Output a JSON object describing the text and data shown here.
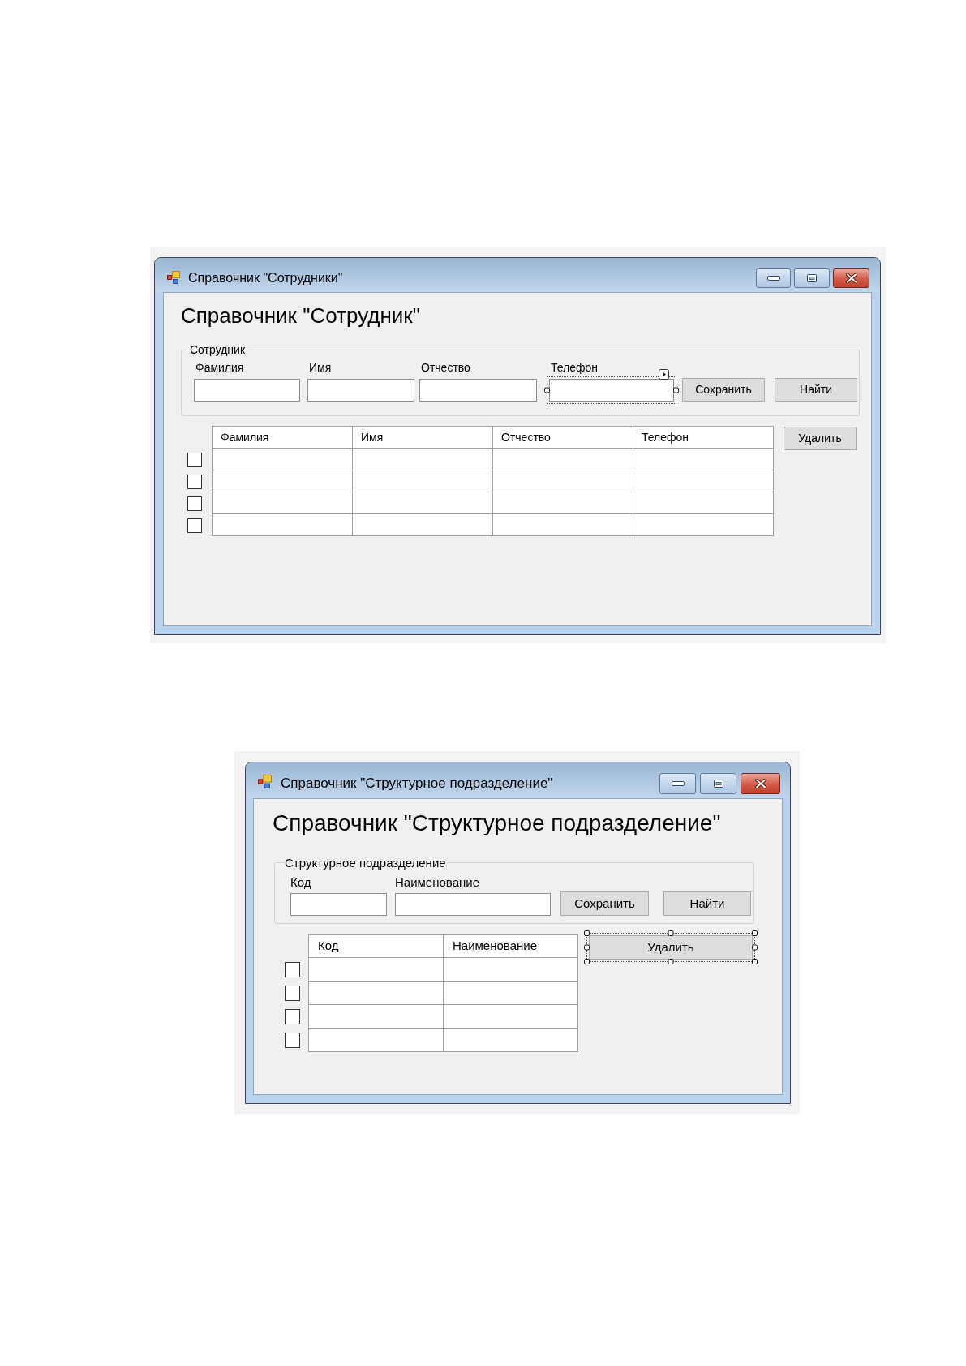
{
  "windows": [
    {
      "title": "Справочник \"Сотрудники\"",
      "heading": "Справочник \"Сотрудник\"",
      "group": {
        "legend": "Сотрудник",
        "fields": [
          {
            "label": "Фамилия",
            "selected": false
          },
          {
            "label": "Имя",
            "selected": false
          },
          {
            "label": "Отчество",
            "selected": false
          },
          {
            "label": "Телефон",
            "selected": true
          }
        ],
        "buttons": [
          {
            "label": "Сохранить",
            "selected": false
          },
          {
            "label": "Найти",
            "selected": false
          }
        ]
      },
      "grid": {
        "columns": [
          "Фамилия",
          "Имя",
          "Отчество",
          "Телефон"
        ],
        "rows": [
          {
            "checked": false
          },
          {
            "checked": false
          },
          {
            "checked": false
          },
          {
            "checked": false
          }
        ]
      },
      "delete_button": {
        "label": "Удалить",
        "selected": false
      }
    },
    {
      "title": "Справочник \"Структурное подразделение\"",
      "heading": "Справочник \"Структурное подразделение\"",
      "group": {
        "legend": "Структурное подразделение",
        "fields": [
          {
            "label": "Код",
            "selected": false
          },
          {
            "label": "Наименование",
            "selected": false
          }
        ],
        "buttons": [
          {
            "label": "Сохранить",
            "selected": false
          },
          {
            "label": "Найти",
            "selected": false
          }
        ]
      },
      "grid": {
        "columns": [
          "Код",
          "Наименование"
        ],
        "rows": [
          {
            "checked": false
          },
          {
            "checked": false
          },
          {
            "checked": false
          },
          {
            "checked": false
          }
        ]
      },
      "delete_button": {
        "label": "Удалить",
        "selected": true
      }
    }
  ]
}
